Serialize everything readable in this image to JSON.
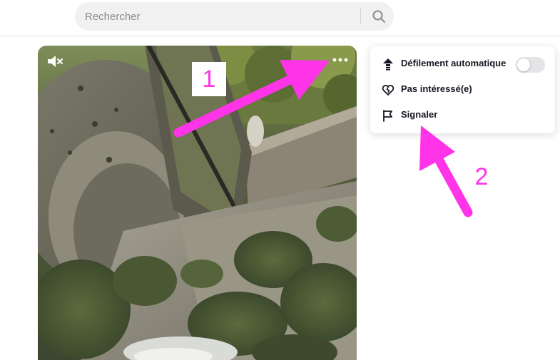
{
  "search": {
    "placeholder": "Rechercher",
    "value": "",
    "button_icon": "search-icon"
  },
  "video": {
    "mute_icon": "speaker-muted-icon",
    "more_icon": "ellipsis-icon"
  },
  "menu": {
    "items": [
      {
        "label": "Défilement automatique",
        "icon": "auto-scroll-icon",
        "has_toggle": true,
        "toggle_on": false
      },
      {
        "label": "Pas intéressé(e)",
        "icon": "broken-heart-icon"
      },
      {
        "label": "Signaler",
        "icon": "flag-icon"
      }
    ]
  },
  "annotations": {
    "step_1": "1",
    "step_2": "2",
    "color": "#ff33e8"
  }
}
